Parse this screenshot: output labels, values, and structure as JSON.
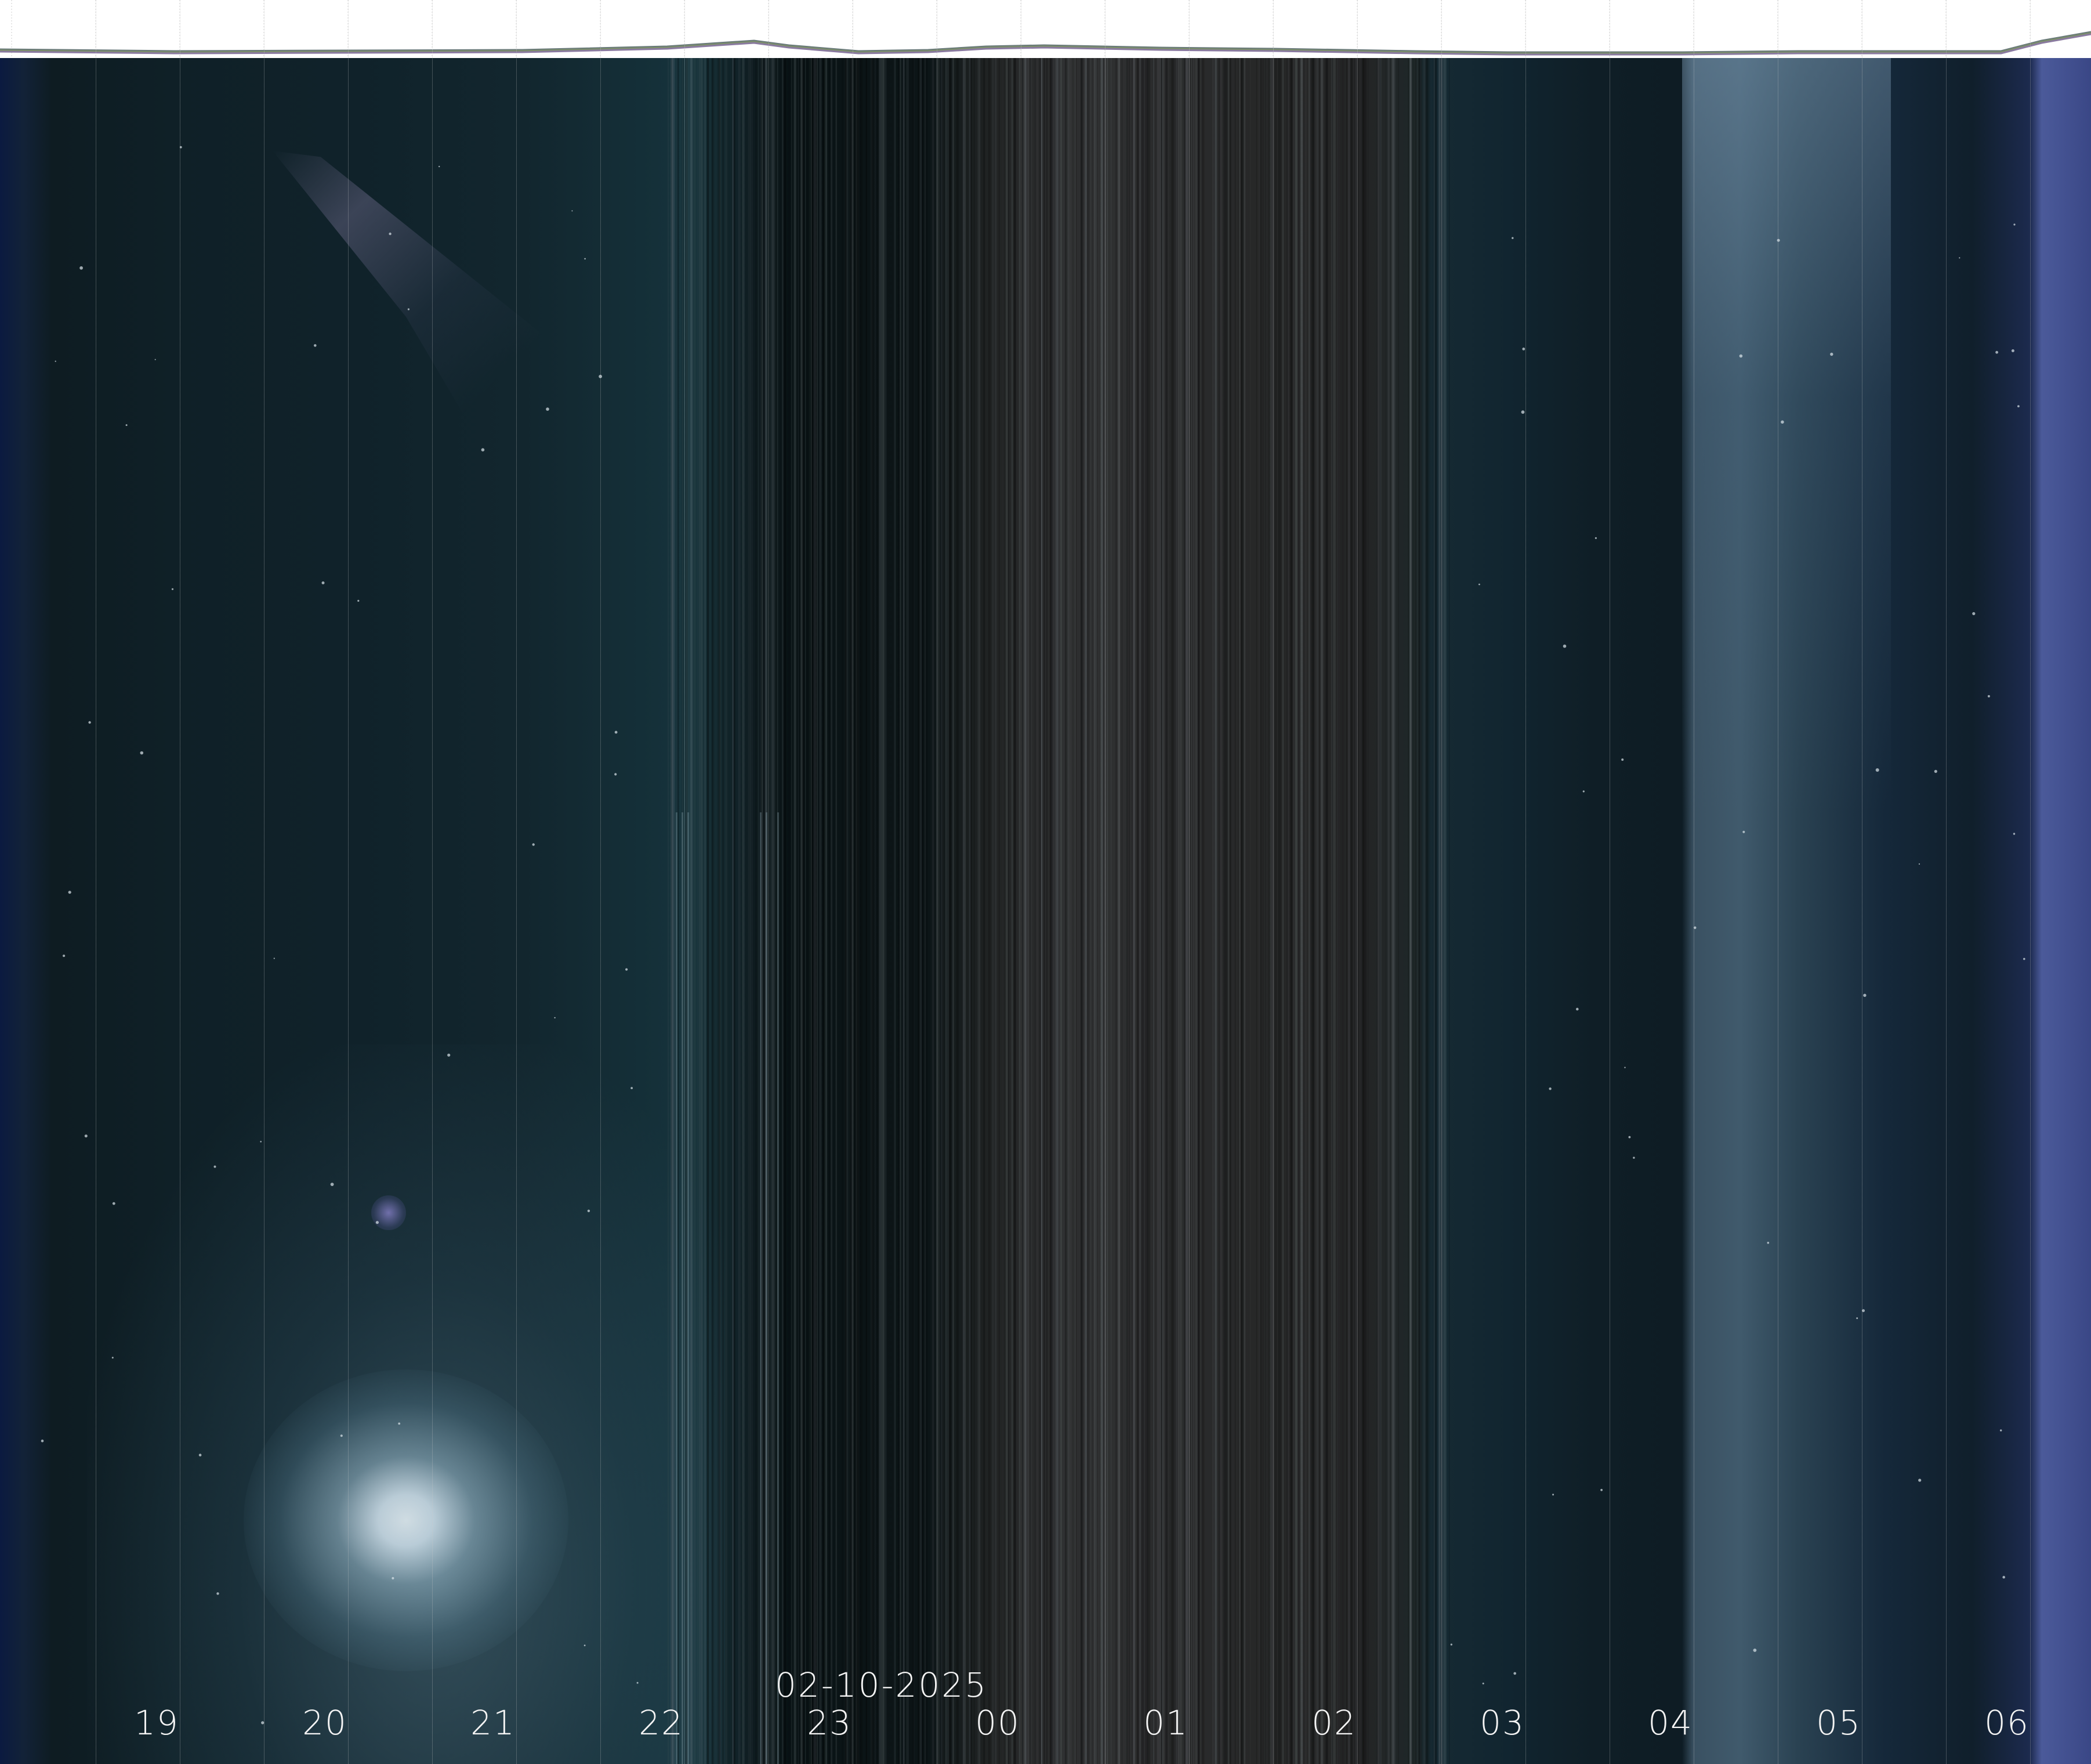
{
  "date": "02-10-2025",
  "hours": [
    "19",
    "20",
    "21",
    "22",
    "23",
    "00",
    "01",
    "02",
    "03",
    "04",
    "05",
    "06"
  ],
  "colors": {
    "strip_background": "#ffffff",
    "strip_line": "#6a7a7a",
    "grid": "#c8c8c8",
    "label": "#f4f4f4"
  }
}
